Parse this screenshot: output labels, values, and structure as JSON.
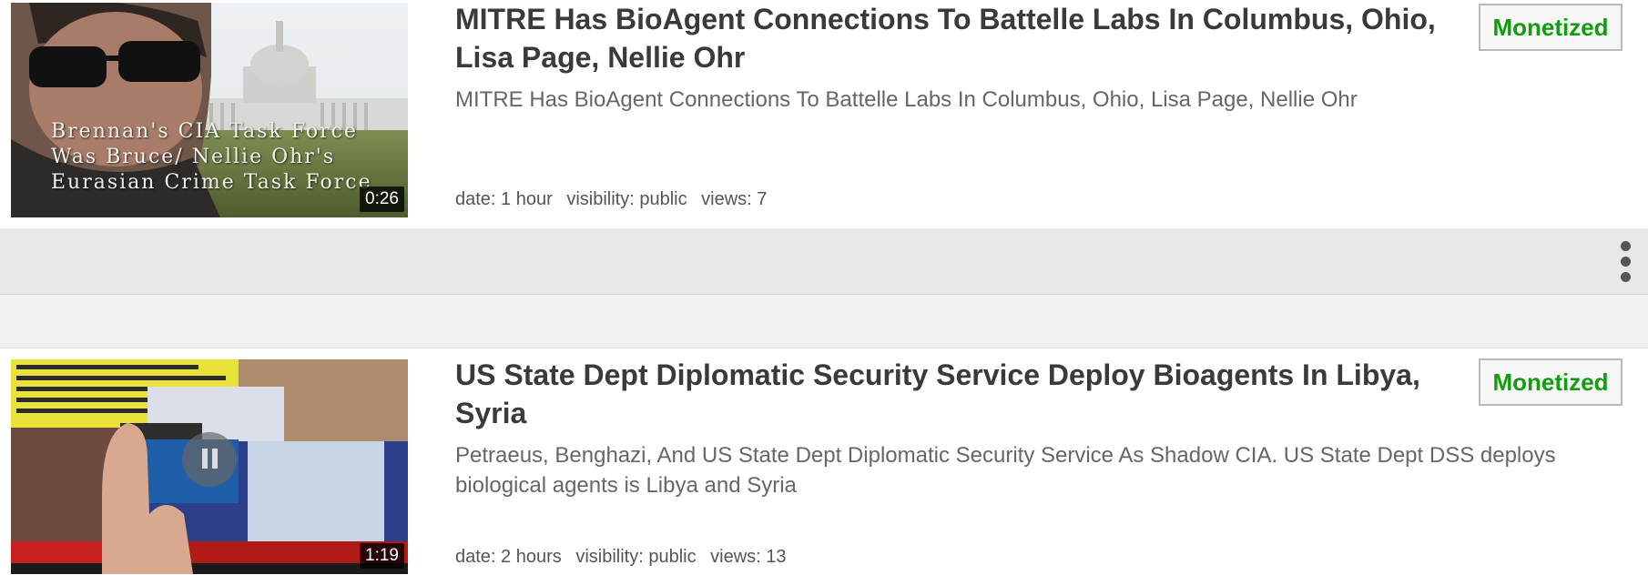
{
  "videos": [
    {
      "title": "MITRE Has BioAgent Connections To Battelle Labs In Columbus, Ohio, Lisa Page, Nellie Ohr",
      "description": "MITRE Has BioAgent Connections To Battelle Labs In Columbus, Ohio, Lisa Page, Nellie Ohr",
      "duration": "0:26",
      "thumbnail_text": "Brennan's CIA Task Force\nWas Bruce/ Nellie Ohr's\nEurasian Crime Task Force",
      "date": "date: 1 hour",
      "visibility": "visibility: public",
      "views": "views: 7",
      "badge": "Monetized"
    },
    {
      "title": "US State Dept Diplomatic Security Service Deploy Bioagents In Libya, Syria",
      "description": "Petraeus, Benghazi, And US State Dept Diplomatic Security Service As Shadow CIA. US State Dept DSS deploys biological agents is Libya and Syria",
      "duration": "1:19",
      "date": "date: 2 hours",
      "visibility": "visibility: public",
      "views": "views: 13",
      "badge": "Monetized"
    }
  ],
  "toolbar": {
    "more_icon": "more-vertical-icon"
  },
  "colors": {
    "badge_text": "#119c11",
    "title_text": "#3a3a3a",
    "toolbar_bg": "#e8e8e8"
  }
}
